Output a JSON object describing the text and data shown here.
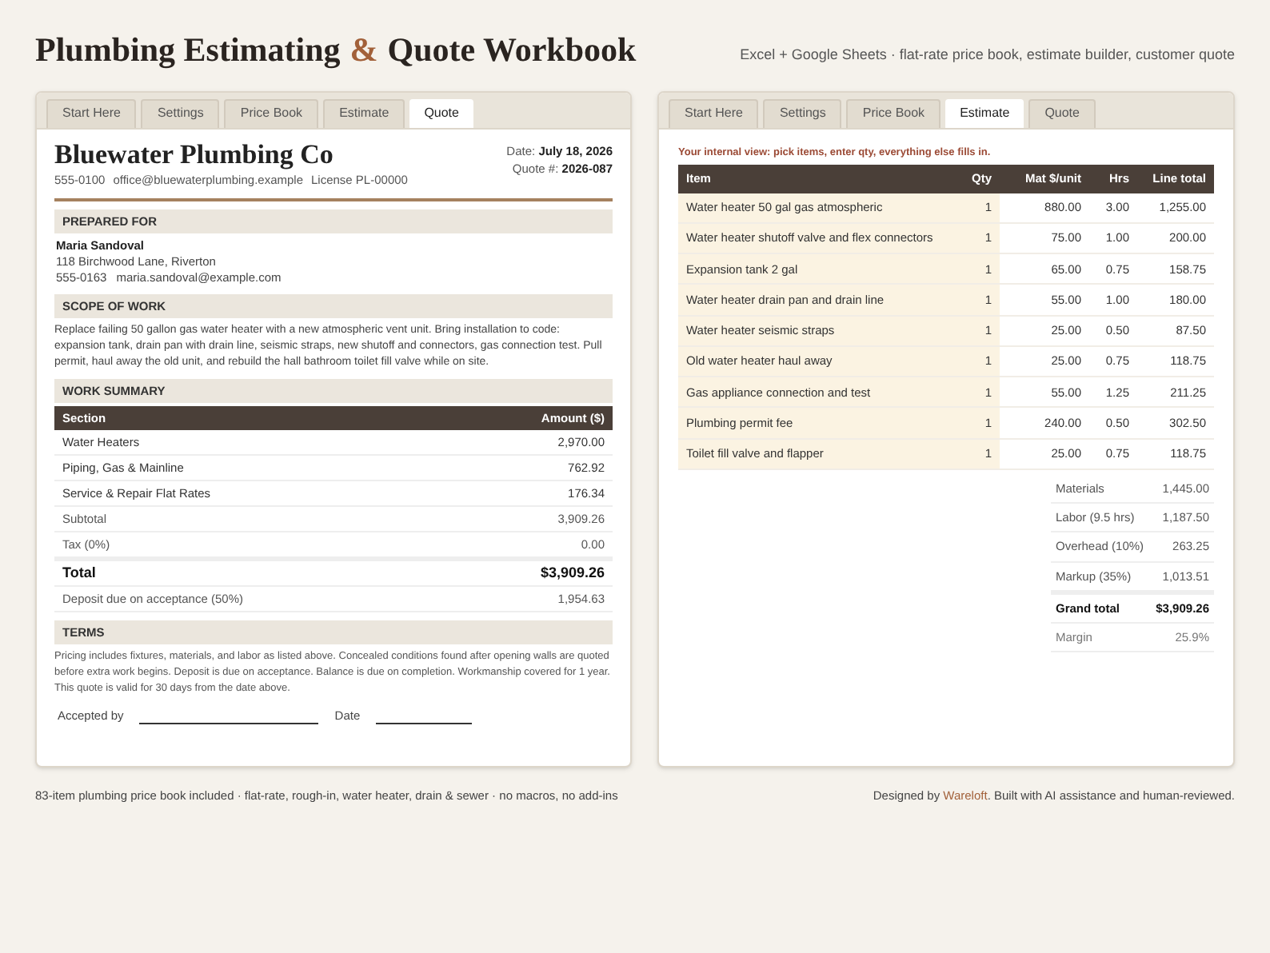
{
  "header": {
    "title": [
      {
        "text": "Plumbing Estimating",
        "accent": false
      },
      {
        "text": "&",
        "accent": true
      },
      {
        "text": "Quote Workbook",
        "accent": false
      }
    ],
    "subtitle": "Excel + Google Sheets · flat-rate price book, estimate builder, customer quote"
  },
  "quote_panel": {
    "tabs": [
      {
        "label": "Start Here",
        "selected": false
      },
      {
        "label": "Settings",
        "selected": false
      },
      {
        "label": "Price Book",
        "selected": false
      },
      {
        "label": "Estimate",
        "selected": false
      },
      {
        "label": "Quote",
        "selected": true
      }
    ],
    "company": "Bluewater Plumbing Co",
    "contact": [
      "555-0100",
      "office@bluewaterplumbing.example",
      "License PL-00000"
    ],
    "date_label": "Date:",
    "date": "July 18, 2026",
    "quote_label": "Quote #:",
    "quote_number": "2026-087",
    "prepared_for": {
      "heading": "PREPARED FOR",
      "name": "Maria Sandoval",
      "address": "118 Birchwood Lane, Riverton",
      "phone": "555-0163",
      "email": "maria.sandoval@example.com"
    },
    "scope": {
      "heading": "SCOPE OF WORK",
      "text": "Replace failing 50 gallon gas water heater with a new atmospheric vent unit. Bring installation to code: expansion tank, drain pan with drain line, seismic straps, new shutoff and connectors, gas connection test. Pull permit, haul away the old unit, and rebuild the hall bathroom toilet fill valve while on site."
    },
    "summary": {
      "heading": "WORK SUMMARY",
      "columns": [
        "Section",
        "Amount ($)"
      ],
      "rows": [
        {
          "kind": "line",
          "label": "Water Heaters",
          "amount": "2,970.00"
        },
        {
          "kind": "line",
          "label": "Piping, Gas & Mainline",
          "amount": "762.92"
        },
        {
          "kind": "line",
          "label": "Service & Repair Flat Rates",
          "amount": "176.34"
        },
        {
          "kind": "muted",
          "label": "Subtotal",
          "amount": "3,909.26"
        },
        {
          "kind": "muted",
          "label": "Tax (0%)",
          "amount": "0.00"
        },
        {
          "kind": "total",
          "label": "Total",
          "amount": "$3,909.26"
        },
        {
          "kind": "muted",
          "label": "Deposit due on acceptance (50%)",
          "amount": "1,954.63"
        }
      ]
    },
    "terms": {
      "heading": "TERMS",
      "text": "Pricing includes fixtures, materials, and labor as listed above. Concealed conditions found after opening walls are quoted before extra work begins. Deposit is due on acceptance. Balance is due on completion. Workmanship covered for 1 year. This quote is valid for 30 days from the date above."
    },
    "signature": {
      "accepted_label": "Accepted by",
      "date_label": "Date"
    }
  },
  "estimate_panel": {
    "tabs": [
      {
        "label": "Start Here",
        "selected": false
      },
      {
        "label": "Settings",
        "selected": false
      },
      {
        "label": "Price Book",
        "selected": false
      },
      {
        "label": "Estimate",
        "selected": true
      },
      {
        "label": "Quote",
        "selected": false
      }
    ],
    "note": "Your internal view: pick items, enter qty, everything else fills in.",
    "columns": [
      "Item",
      "Qty",
      "Mat $/unit",
      "Hrs",
      "Line total"
    ],
    "rows": [
      {
        "item": "Water heater 50 gal gas atmospheric",
        "qty": "1",
        "mat": "880.00",
        "hrs": "3.00",
        "total": "1,255.00"
      },
      {
        "item": "Water heater shutoff valve and flex connectors",
        "qty": "1",
        "mat": "75.00",
        "hrs": "1.00",
        "total": "200.00"
      },
      {
        "item": "Expansion tank 2 gal",
        "qty": "1",
        "mat": "65.00",
        "hrs": "0.75",
        "total": "158.75"
      },
      {
        "item": "Water heater drain pan and drain line",
        "qty": "1",
        "mat": "55.00",
        "hrs": "1.00",
        "total": "180.00"
      },
      {
        "item": "Water heater seismic straps",
        "qty": "1",
        "mat": "25.00",
        "hrs": "0.50",
        "total": "87.50"
      },
      {
        "item": "Old water heater haul away",
        "qty": "1",
        "mat": "25.00",
        "hrs": "0.75",
        "total": "118.75"
      },
      {
        "item": "Gas appliance connection and test",
        "qty": "1",
        "mat": "55.00",
        "hrs": "1.25",
        "total": "211.25"
      },
      {
        "item": "Plumbing permit fee",
        "qty": "1",
        "mat": "240.00",
        "hrs": "0.50",
        "total": "302.50"
      },
      {
        "item": "Toilet fill valve and flapper",
        "qty": "1",
        "mat": "25.00",
        "hrs": "0.75",
        "total": "118.75"
      }
    ],
    "totals": [
      {
        "kind": "line",
        "label": "Materials",
        "value": "1,445.00"
      },
      {
        "kind": "line",
        "label": "Labor (9.5 hrs)",
        "value": "1,187.50"
      },
      {
        "kind": "line",
        "label": "Overhead (10%)",
        "value": "263.25"
      },
      {
        "kind": "line",
        "label": "Markup (35%)",
        "value": "1,013.51"
      },
      {
        "kind": "grand",
        "label": "Grand total",
        "value": "$3,909.26"
      },
      {
        "kind": "margin",
        "label": "Margin",
        "value": "25.9%"
      }
    ]
  },
  "footer": {
    "left": "83-item plumbing price book included · flat-rate, rough-in, water heater, drain & sewer · no macros, no add-ins",
    "right": [
      {
        "text": "Designed by ",
        "link": false
      },
      {
        "text": "Wareloft",
        "link": true
      },
      {
        "text": ". Built with AI assistance and human-reviewed.",
        "link": false
      }
    ]
  }
}
